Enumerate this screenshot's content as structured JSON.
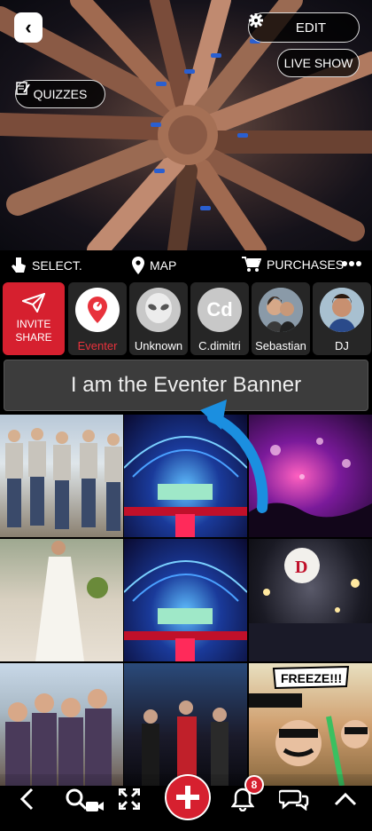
{
  "header": {
    "edit_label": "EDIT",
    "live_show_label": "LIVE SHOW",
    "quizzes_label": "QUIZZES"
  },
  "toolbar": {
    "select_label": "SELECT.",
    "map_label": "MAP",
    "purchases_label": "PURCHASES"
  },
  "stories": {
    "invite_line1": "INVITE",
    "invite_line2": "SHARE",
    "items": [
      {
        "label": "Eventer",
        "label_color": "#e8323c"
      },
      {
        "label": "Unknown"
      },
      {
        "label": "C.dimitri",
        "initials": "Cd"
      },
      {
        "label": "Sebastian"
      },
      {
        "label": "DJ"
      }
    ]
  },
  "banner": {
    "text": "I am the Eventer Banner"
  },
  "bottom_nav": {
    "notification_count": "8"
  },
  "colors": {
    "accent_red": "#d6202f",
    "arrow_blue": "#1b8fe0"
  }
}
